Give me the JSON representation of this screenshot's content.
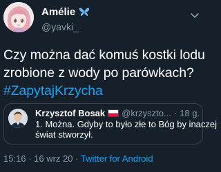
{
  "author": {
    "display_name": "Amélie",
    "handle": "@yavki_",
    "name_icon": "butterfly-icon",
    "avatar": "anime-avatar"
  },
  "tweet": {
    "line1": "Czy można dać komuś kostki lodu",
    "line2": "zrobione z wody po parówkach?",
    "hashtag": "#ZapytajKrzycha"
  },
  "quoted": {
    "display_name": "Krzysztof Bosak",
    "flag_icon": "poland-flag-icon",
    "handle": "@krzyszto...",
    "separator": "·",
    "time": "18 g.",
    "line1": "1. Można. Gdyby to było złe to Bóg by inaczej",
    "line2": "świat stworzył."
  },
  "meta": {
    "time": "15:16",
    "separator": "·",
    "date": "16 wrz 20",
    "separator2": "·",
    "source": "Twitter for Android"
  },
  "colors": {
    "background": "#15202b",
    "link": "#1da1f2",
    "muted": "#8899a6",
    "text": "#ffffff"
  }
}
